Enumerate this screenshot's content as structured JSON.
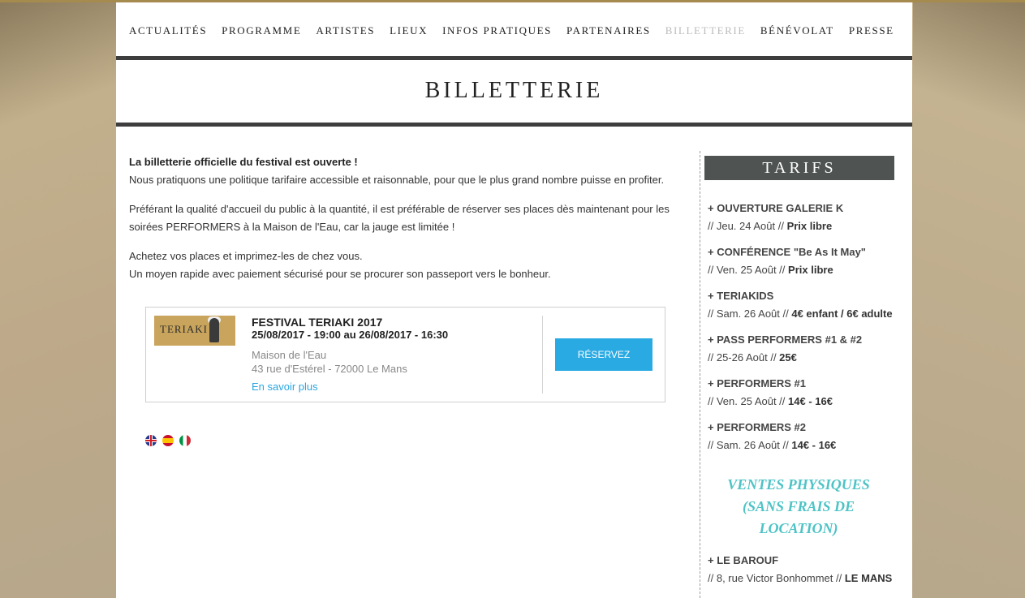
{
  "nav": {
    "items": [
      "ACTUALITÉS",
      "PROGRAMME",
      "ARTISTES",
      "LIEUX",
      "INFOS PRATIQUES",
      "PARTENAIRES",
      "BILLETTERIE",
      "BÉNÉVOLAT",
      "PRESSE"
    ],
    "active": "BILLETTERIE"
  },
  "page_title": "BILLETTERIE",
  "intro": {
    "p1_bold": "La billetterie officielle du festival est ouverte !",
    "p1_rest": "Nous pratiquons une politique tarifaire accessible et raisonnable, pour que le plus grand nombre puisse en profiter.",
    "p2": "Préférant la qualité d'accueil du public à la quantité, il est préférable de réserver ses places dès maintenant pour les soirées PERFORMERS à la Maison de l'Eau, car la jauge est limitée !",
    "p3_line1": "Achetez vos places et imprimez-les de chez vous.",
    "p3_line2": "Un moyen rapide avec paiement sécurisé pour se procurer son passeport vers le bonheur."
  },
  "event": {
    "thumb_text": "TERIAKI",
    "title": "FESTIVAL TERIAKI 2017",
    "dates": "25/08/2017 - 19:00 au 26/08/2017 - 16:30",
    "venue": "Maison de l'Eau",
    "address": "43 rue d'Estérel - 72000 Le Mans",
    "link": "En savoir plus",
    "button": "RÉSERVEZ"
  },
  "flags": [
    "flag-uk-icon",
    "flag-es-icon",
    "flag-it-icon"
  ],
  "sidebar": {
    "heading": "TARIFS",
    "items": [
      {
        "name": "+ OUVERTURE GALERIE K",
        "date": "// Jeu. 24 Août // ",
        "price": "Prix libre"
      },
      {
        "name": "+ CONFÉRENCE \"Be As It May\"",
        "date": "// Ven. 25 Août // ",
        "price": "Prix libre"
      },
      {
        "name": "+ TERIAKIDS",
        "date": "// Sam. 26 Août // ",
        "price": "4€ enfant / 6€ adulte"
      },
      {
        "name": "+ PASS PERFORMERS #1 & #2",
        "date": "// 25-26 Août // ",
        "price": "25€"
      },
      {
        "name": "+ PERFORMERS #1",
        "date": "// Ven. 25 Août // ",
        "price": "14€ - 16€"
      },
      {
        "name": "+ PERFORMERS #2",
        "date": "// Sam. 26 Août // ",
        "price": "14€ - 16€"
      }
    ],
    "ventes_line1": "VENTES PHYSIQUES",
    "ventes_line2": "(SANS FRAIS DE",
    "ventes_line3": "LOCATION)",
    "barouf_name": "+ LE BAROUF",
    "barouf_addr": "// 8, rue Victor Bonhommet // ",
    "barouf_city": "LE MANS"
  },
  "colors": {
    "accent": "#29aae3",
    "ventes": "#4ec3c6",
    "dark_bar": "#3d3d3d",
    "tarifs_bg": "#4f5452"
  }
}
